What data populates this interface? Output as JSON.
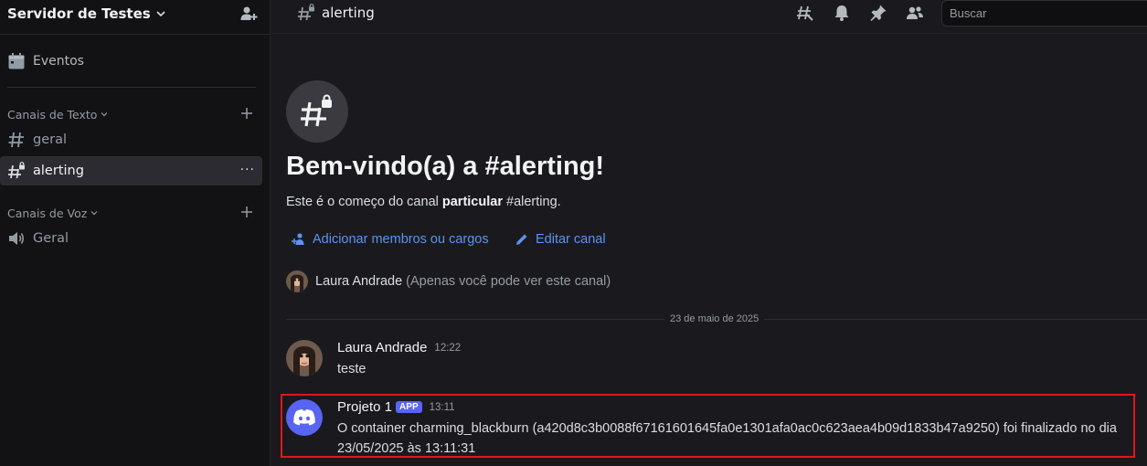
{
  "server": {
    "name": "Servidor de Testes"
  },
  "sidebar": {
    "events_label": "Eventos",
    "categories": [
      {
        "label": "Canais de Texto"
      },
      {
        "label": "Canais de Voz"
      }
    ],
    "text_channels": [
      {
        "name": "geral",
        "icon": "hashtag-icon"
      },
      {
        "name": "alerting",
        "icon": "private-hashtag-icon",
        "active": true,
        "more": "···"
      }
    ],
    "voice_channels": [
      {
        "name": "Geral",
        "icon": "speaker-icon"
      }
    ]
  },
  "topbar": {
    "channel_name": "alerting",
    "icons": [
      "threads-icon",
      "bell-icon",
      "pin-icon",
      "members-icon"
    ],
    "search_placeholder": "Buscar"
  },
  "welcome": {
    "title": "Bem-vindo(a) a #alerting!",
    "desc_prefix": "Este é o começo do canal ",
    "desc_bold": "particular",
    "desc_suffix": " #alerting.",
    "add_members_label": "Adicionar membros ou cargos",
    "edit_channel_label": "Editar canal",
    "member_name": "Laura Andrade",
    "member_note": "(Apenas você pode ver este canal)"
  },
  "messages": {
    "date_separator": "23 de maio de 2025",
    "items": [
      {
        "author": "Laura Andrade",
        "time": "12:22",
        "text": "teste"
      },
      {
        "author": "Projeto 1",
        "tag": "APP",
        "time": "13:11",
        "text": "O container charming_blackburn (a420d8c3b0088f67161601645fa0e1301afa0ac0c623aea4b09d1833b47a9250) foi finalizado no dia 23/05/2025 às 13:11:31"
      }
    ]
  },
  "colors": {
    "accent": "#5865f2",
    "link": "#5a93f0",
    "highlight": "#e0161c",
    "background": "#1a1a1e",
    "sidebar": "#121214"
  }
}
